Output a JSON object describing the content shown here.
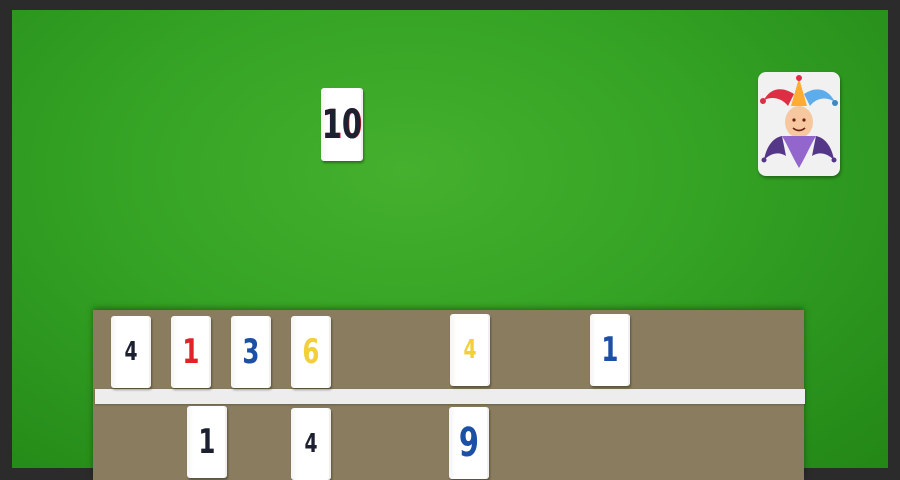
{
  "table": {
    "tiles": [
      {
        "value": "10",
        "color": "black"
      }
    ],
    "joker_icon": "jester-icon"
  },
  "rack": {
    "top_row": [
      {
        "value": "4",
        "color": "black"
      },
      {
        "value": "1",
        "color": "red"
      },
      {
        "value": "3",
        "color": "blue"
      },
      {
        "value": "6",
        "color": "yellow"
      },
      {
        "value": "4",
        "color": "yellow"
      },
      {
        "value": "1",
        "color": "blue"
      }
    ],
    "bottom_row": [
      {
        "value": "1",
        "color": "black"
      },
      {
        "value": "4",
        "color": "black"
      },
      {
        "value": "9",
        "color": "blue"
      }
    ]
  },
  "colors": {
    "black": "#1d2030",
    "red": "#e0232b",
    "blue": "#1c4fa6",
    "yellow": "#f3cf3c",
    "felt": "#34a224",
    "rack": "#8a7d5f"
  }
}
